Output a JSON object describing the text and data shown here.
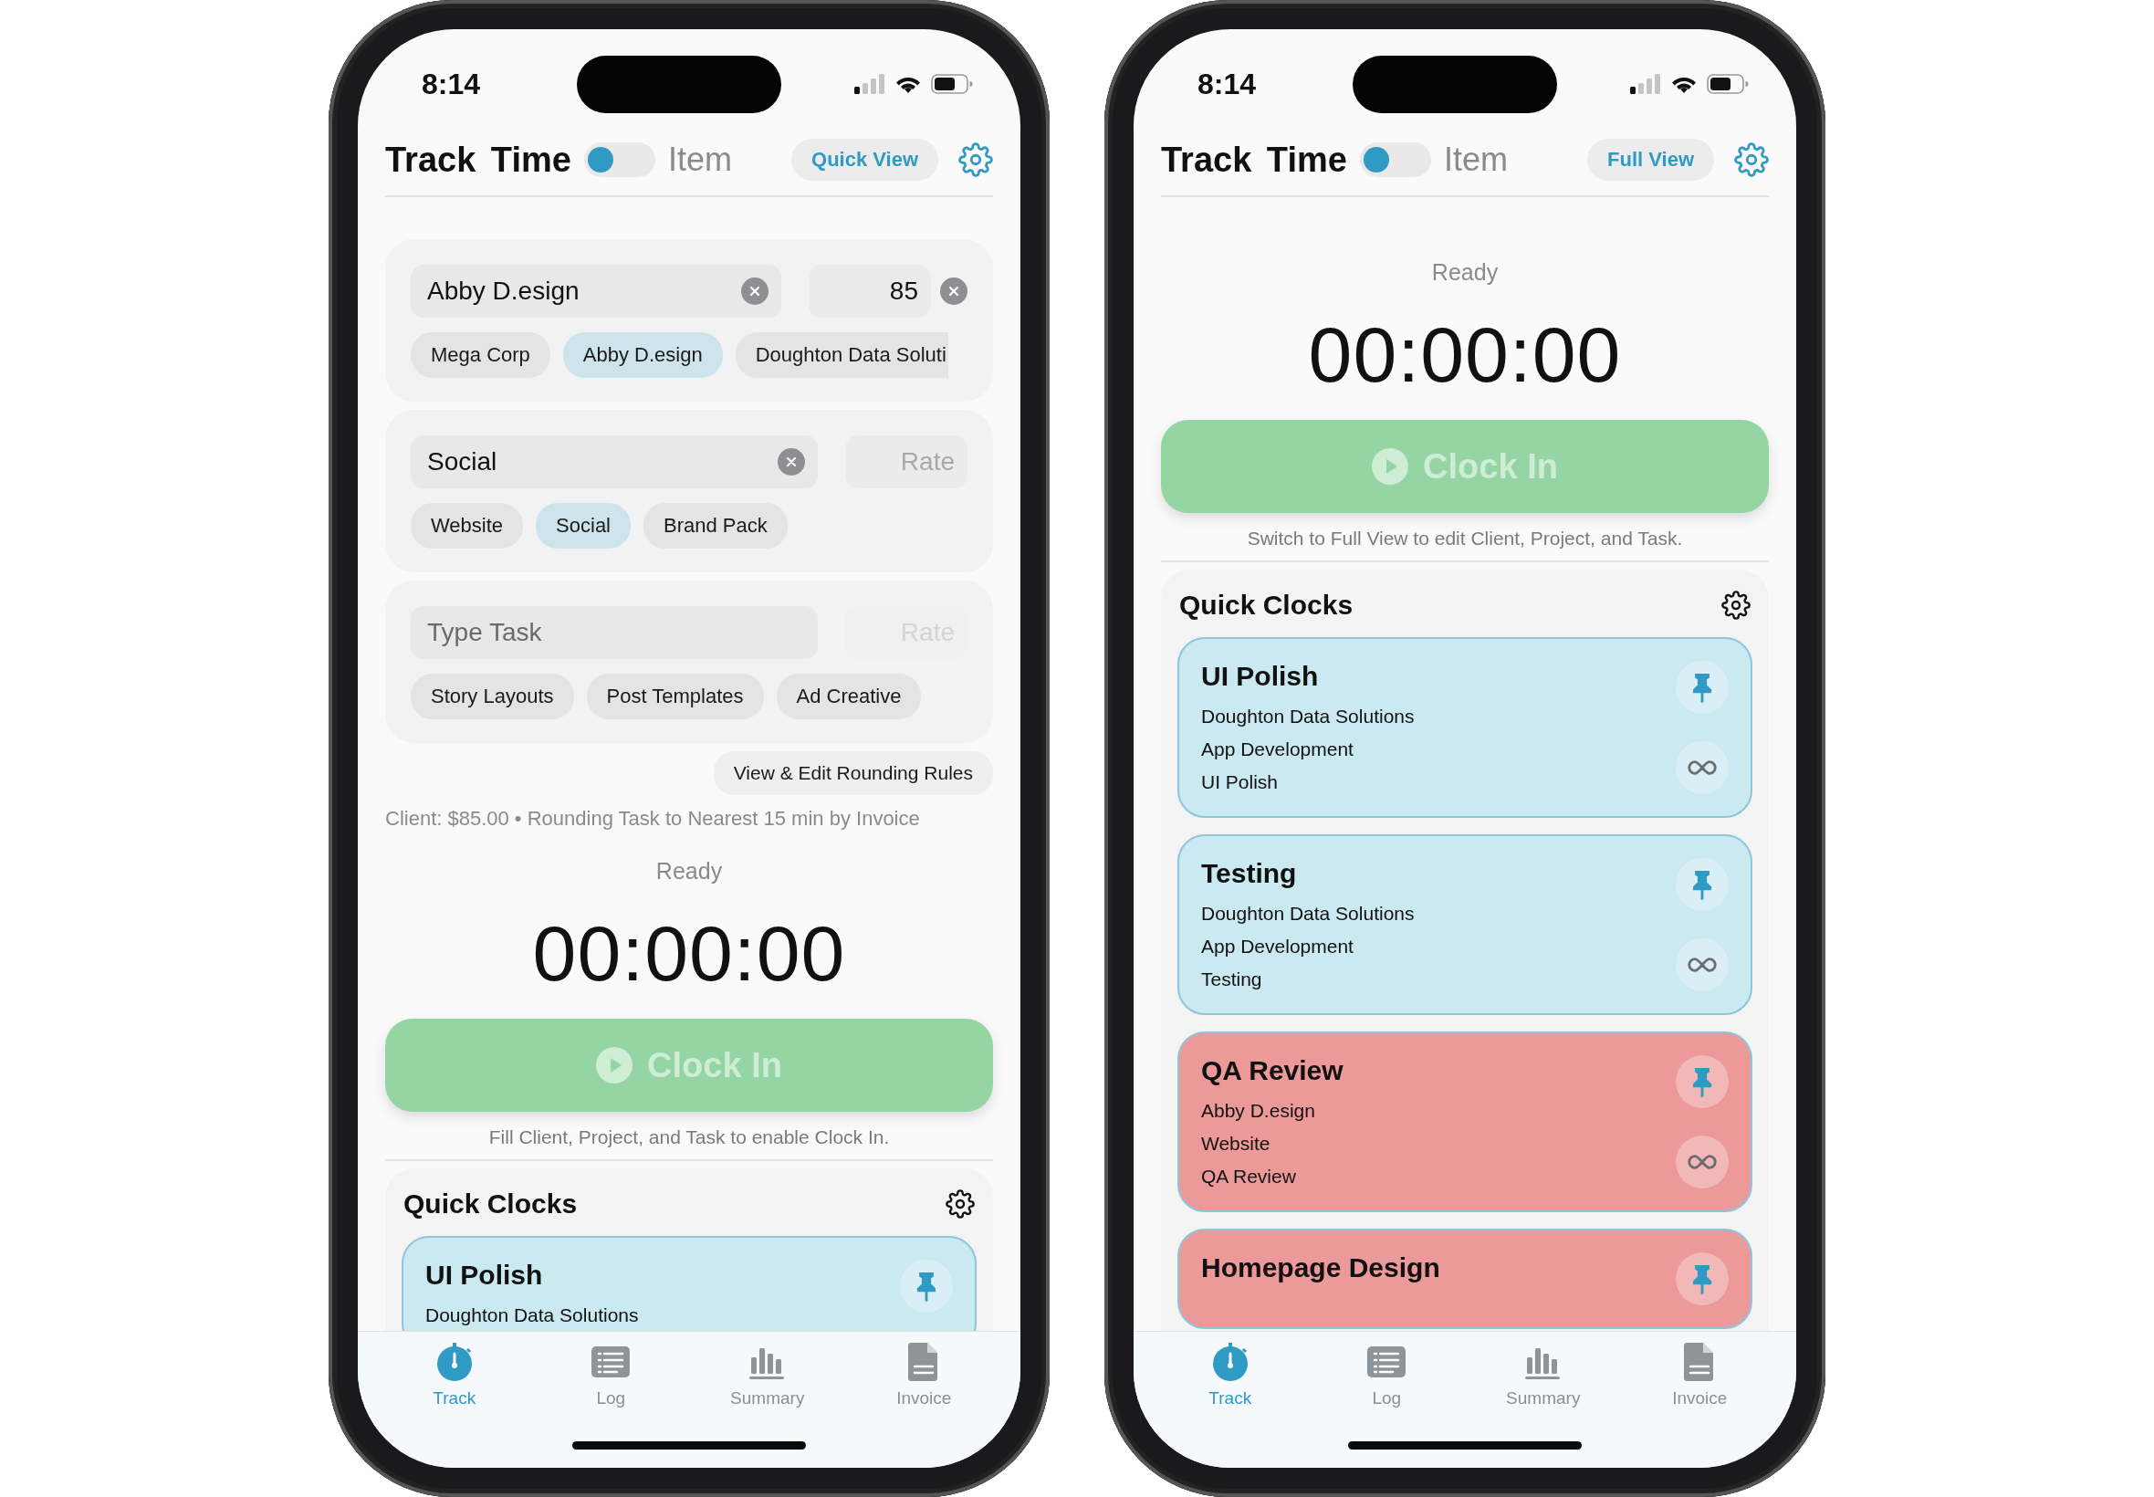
{
  "phones": [
    {
      "status_bar": {
        "time": "8:14"
      },
      "header": {
        "title": "Track Time",
        "toggle": {
          "on": false
        },
        "toggle_label": "Item",
        "view_button": "Quick View"
      },
      "form": {
        "sections": [
          {
            "field": {
              "value": "Abby D.esign",
              "clearable": true
            },
            "rate": {
              "value": "85",
              "clearable": true,
              "disabled": false
            },
            "chips": [
              {
                "label": "Mega Corp",
                "selected": false,
                "truncated": false
              },
              {
                "label": "Abby D.esign",
                "selected": true,
                "truncated": false
              },
              {
                "label": "Doughton Data Soluti",
                "selected": false,
                "truncated": true
              }
            ]
          },
          {
            "field": {
              "value": "Social",
              "clearable": true
            },
            "rate": {
              "placeholder": "Rate",
              "clearable": false,
              "disabled": false
            },
            "chips": [
              {
                "label": "Website",
                "selected": false,
                "truncated": false
              },
              {
                "label": "Social",
                "selected": true,
                "truncated": false
              },
              {
                "label": "Brand Pack",
                "selected": false,
                "truncated": false
              }
            ]
          },
          {
            "field": {
              "placeholder": "Type Task",
              "clearable": false
            },
            "rate": {
              "placeholder": "Rate",
              "clearable": false,
              "disabled": true
            },
            "chips": [
              {
                "label": "Story Layouts",
                "selected": false,
                "truncated": false
              },
              {
                "label": "Post Templates",
                "selected": false,
                "truncated": false
              },
              {
                "label": "Ad Creative",
                "selected": false,
                "truncated": false
              }
            ]
          }
        ],
        "rounding_button": "View & Edit Rounding Rules",
        "summary": "Client: $85.00 • Rounding Task to Nearest 15 min by Invoice"
      },
      "timer": {
        "status": "Ready",
        "time": "00:00:00"
      },
      "clock_in": {
        "label": "Clock In",
        "disabled": true
      },
      "hint": "Fill Client, Project, and Task to enable Clock In.",
      "quick_clocks": {
        "title": "Quick Clocks",
        "clocks": [
          {
            "title": "UI Polish",
            "lines": [
              "Doughton Data Solutions"
            ],
            "color": "#cbe9f1",
            "pinned": true,
            "repeat": false
          }
        ]
      },
      "tab_bar": [
        {
          "label": "Track",
          "selected": true
        },
        {
          "label": "Log",
          "selected": false
        },
        {
          "label": "Summary",
          "selected": false
        },
        {
          "label": "Invoice",
          "selected": false
        }
      ]
    },
    {
      "status_bar": {
        "time": "8:14"
      },
      "header": {
        "title": "Track Time",
        "toggle": {
          "on": false
        },
        "toggle_label": "Item",
        "view_button": "Full View"
      },
      "timer": {
        "status": "Ready",
        "time": "00:00:00"
      },
      "clock_in": {
        "label": "Clock In",
        "disabled": true
      },
      "hint": "Switch to Full View to edit Client, Project, and Task.",
      "quick_clocks": {
        "title": "Quick Clocks",
        "clocks": [
          {
            "title": "UI Polish",
            "lines": [
              "Doughton Data Solutions",
              "App Development",
              "UI Polish"
            ],
            "color": "#cbe9f1",
            "pinned": true,
            "repeat": true
          },
          {
            "title": "Testing",
            "lines": [
              "Doughton Data Solutions",
              "App Development",
              "Testing"
            ],
            "color": "#cbe9f1",
            "pinned": true,
            "repeat": true
          },
          {
            "title": "QA Review",
            "lines": [
              "Abby D.esign",
              "Website",
              "QA Review"
            ],
            "color": "#ec9a99",
            "pinned": true,
            "repeat": true
          },
          {
            "title": "Homepage Design",
            "color": "#ec9a99",
            "pinned": true,
            "repeat": false
          }
        ]
      },
      "tab_bar": [
        {
          "label": "Track",
          "selected": true
        },
        {
          "label": "Log",
          "selected": false
        },
        {
          "label": "Summary",
          "selected": false
        },
        {
          "label": "Invoice",
          "selected": false
        }
      ]
    }
  ]
}
